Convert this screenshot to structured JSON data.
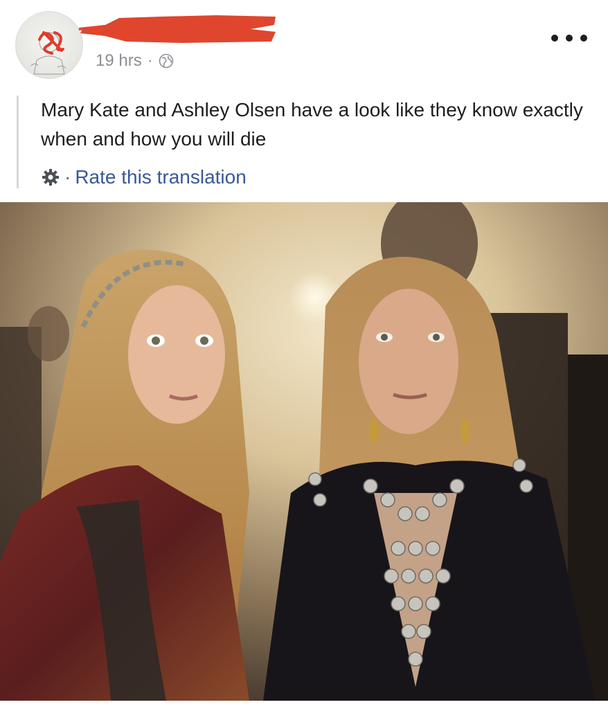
{
  "post": {
    "timestamp": "19 hrs",
    "separator": "·",
    "privacy_icon": "globe-icon",
    "more_icon": "more-options-icon",
    "text": "Mary Kate and Ashley Olsen have a look like they know exactly when and how you will die",
    "translation": {
      "icon": "gear-icon",
      "separator": "·",
      "rate_label": "Rate this translation"
    },
    "photo": {
      "subject": "photo-two-women"
    }
  },
  "colors": {
    "link": "#385898",
    "text": "#1c1e21",
    "meta": "#8c8f94",
    "redaction": "#e0452e"
  }
}
